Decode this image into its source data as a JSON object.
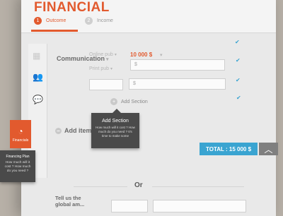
{
  "header": {
    "title": "FINANCIAL",
    "steps": [
      {
        "num": "1",
        "label": "Outcome"
      },
      {
        "num": "2",
        "label": "Income"
      }
    ]
  },
  "sidebar": {
    "icons": [
      "chart-icon",
      "users-icon",
      "chat-icon"
    ],
    "active_label": "Financials",
    "active_icon": "pie-chart-icon"
  },
  "form": {
    "row_label": "Communication",
    "fields": {
      "online_pub_label": "Online pub",
      "online_pub_value": "10 000 $",
      "print_pub_label": "Print pub",
      "print_pub_placeholder": "$",
      "custom_placeholder": "$"
    },
    "add_section_label": "Add Section",
    "add_item_label": "Add item",
    "tooltip": {
      "title": "Add Section",
      "body": "How much will it cost ? How much do you need ? It's time to make some"
    },
    "left_tooltip": {
      "title": "Financing Plan",
      "body": "How much will it cost ? How much do you need ?"
    },
    "total": "TOTAL : 15 000 $",
    "or": "Or",
    "bottom_label_1": "Tell us the",
    "bottom_label_2": "global am..."
  },
  "colors": {
    "accent": "#e25a2e",
    "blue": "#3aa4d1",
    "dark": "#4a4a4a"
  }
}
